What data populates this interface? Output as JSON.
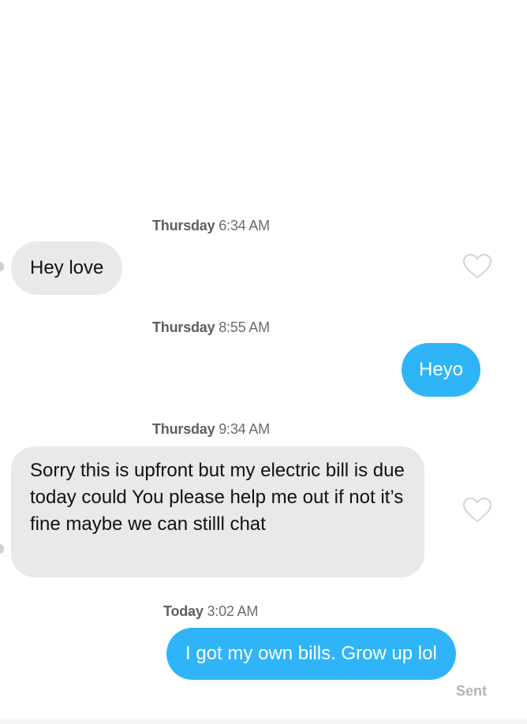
{
  "messages": [
    {
      "timestamp_day": "Thursday",
      "timestamp_time": "6:34 AM",
      "direction": "incoming",
      "text": "Hey love"
    },
    {
      "timestamp_day": "Thursday",
      "timestamp_time": "8:55 AM",
      "direction": "outgoing",
      "text": "Heyo"
    },
    {
      "timestamp_day": "Thursday",
      "timestamp_time": "9:34 AM",
      "direction": "incoming",
      "text": "Sorry this is upfront but my electric bill is due today could You please help me out if not it’s fine maybe we can stilll chat"
    },
    {
      "timestamp_day": "Today",
      "timestamp_time": "3:02 AM",
      "direction": "outgoing",
      "text": "I got my own bills. Grow up lol"
    }
  ],
  "status": {
    "sent_label": "Sent"
  },
  "icons": {
    "like": "heart-outline-icon"
  },
  "colors": {
    "outgoing_bubble": "#2fb5f7",
    "incoming_bubble": "#e9e9eb",
    "timestamp_text": "#6b6b6b"
  }
}
